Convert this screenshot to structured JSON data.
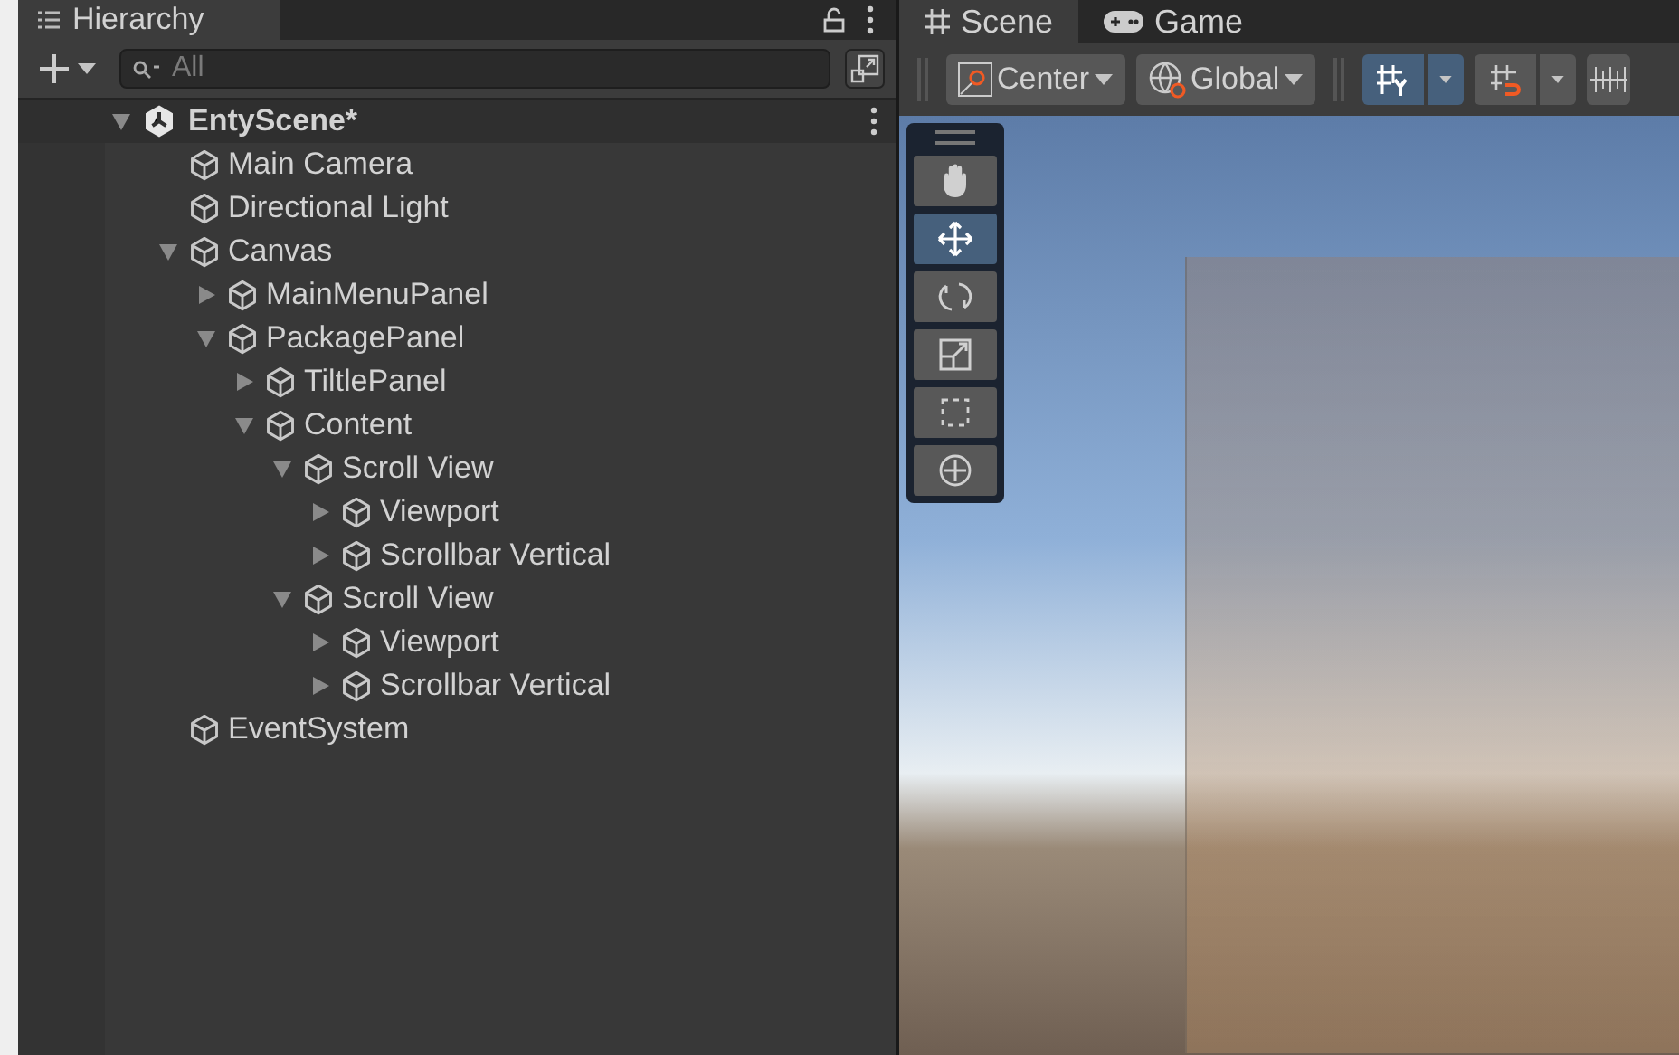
{
  "hierarchy": {
    "tab": {
      "title": "Hierarchy",
      "selected": true
    },
    "search": {
      "placeholder": "All"
    },
    "scene": {
      "name": "EntyScene*",
      "expanded": true,
      "children": [
        {
          "name": "Main Camera"
        },
        {
          "name": "Directional Light"
        },
        {
          "name": "Canvas",
          "expanded": true,
          "children": [
            {
              "name": "MainMenuPanel",
              "expanded": false
            },
            {
              "name": "PackagePanel",
              "expanded": true,
              "children": [
                {
                  "name": "TiltlePanel",
                  "expanded": false
                },
                {
                  "name": "Content",
                  "expanded": true,
                  "children": [
                    {
                      "name": "Scroll View",
                      "expanded": true,
                      "children": [
                        {
                          "name": "Viewport",
                          "expanded": false
                        },
                        {
                          "name": "Scrollbar Vertical",
                          "expanded": false
                        }
                      ]
                    },
                    {
                      "name": "Scroll View",
                      "expanded": true,
                      "children": [
                        {
                          "name": "Viewport",
                          "expanded": false
                        },
                        {
                          "name": "Scrollbar Vertical",
                          "expanded": false
                        }
                      ]
                    }
                  ]
                }
              ]
            }
          ]
        },
        {
          "name": "EventSystem"
        }
      ]
    }
  },
  "scene_view": {
    "tabs": [
      {
        "label": "Scene",
        "kind": "scene",
        "selected": true
      },
      {
        "label": "Game",
        "kind": "game",
        "selected": false
      }
    ],
    "toolbar": [
      {
        "kind": "pivot",
        "label": "Center"
      },
      {
        "kind": "space",
        "label": "Global"
      }
    ],
    "toggles": [
      {
        "kind": "grid",
        "selected": true
      },
      {
        "kind": "snap",
        "selected": false
      }
    ],
    "tools": [
      {
        "kind": "hand",
        "selected": false
      },
      {
        "kind": "move",
        "selected": true
      },
      {
        "kind": "rotate",
        "selected": false
      },
      {
        "kind": "scale",
        "selected": false
      },
      {
        "kind": "rect",
        "selected": false
      },
      {
        "kind": "transform",
        "selected": false
      }
    ]
  }
}
